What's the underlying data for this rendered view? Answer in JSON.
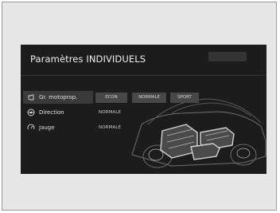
{
  "screen": {
    "title": "Paramètres INDIVIDUELS",
    "top_button_label": "",
    "rows": [
      {
        "label": "Gr. motoprop.",
        "icon": "powertrain-icon"
      },
      {
        "label": "Direction",
        "icon": "steering-icon",
        "value": "NORMALE"
      },
      {
        "label": "Jauge",
        "icon": "gauge-icon",
        "value": "NORMALE"
      }
    ],
    "modes": [
      "ECON",
      "NORMALE",
      "SPORT"
    ]
  }
}
